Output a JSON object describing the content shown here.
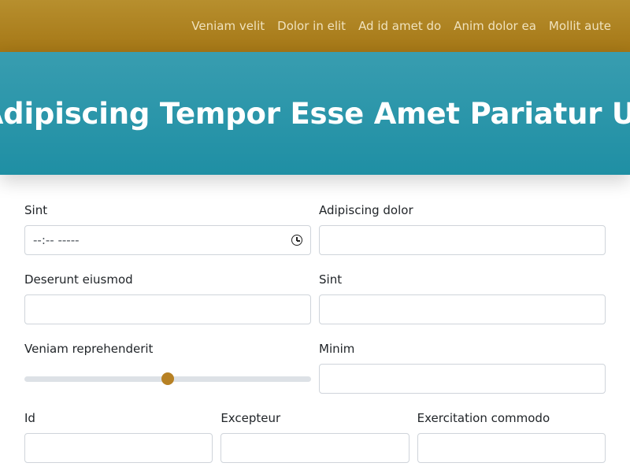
{
  "nav": {
    "links": [
      "Veniam velit",
      "Dolor in elit",
      "Ad id amet do",
      "Anim dolor ea",
      "Mollit aute"
    ]
  },
  "hero": {
    "title": "Adipiscing Tempor Esse Amet Pariatur Ut"
  },
  "form": {
    "row1": {
      "left_label": "Sint",
      "left_time_value": "--:-- -----",
      "right_label": "Adipiscing dolor",
      "right_value": ""
    },
    "row2": {
      "left_label": "Deserunt eiusmod",
      "left_value": "",
      "right_label": "Sint",
      "right_value": ""
    },
    "row3": {
      "left_label": "Veniam reprehenderit",
      "slider_value_percent": 50,
      "right_label": "Minim",
      "right_value": ""
    },
    "row4": {
      "col1_label": "Id",
      "col1_value": "",
      "col2_label": "Excepteur",
      "col2_value": "",
      "col3_label": "Exercitation commodo",
      "col3_value": ""
    }
  },
  "colors": {
    "nav_bg": "#a87c1c",
    "hero_bg": "#2b96aa",
    "slider_thumb": "#b78124"
  },
  "icons": {
    "time_input": "clock-icon"
  }
}
